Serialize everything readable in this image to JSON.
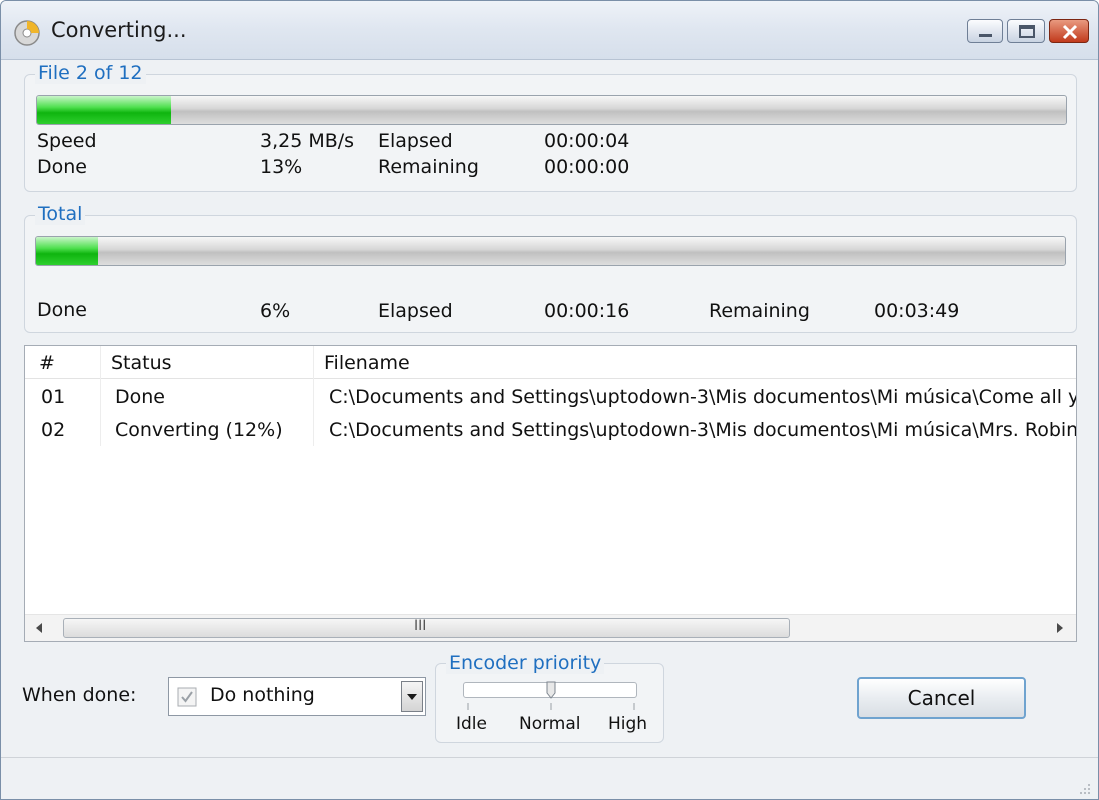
{
  "window": {
    "title": "Converting...",
    "icon": "disc-icon",
    "controls": [
      "minimize-icon",
      "maximize-icon",
      "close-icon"
    ]
  },
  "file_group": {
    "legend": "File 2 of 12",
    "progress_percent": 13,
    "speed_label": "Speed",
    "speed_value": "3,25 MB/s",
    "elapsed_label": "Elapsed",
    "elapsed_value": "00:00:04",
    "done_label": "Done",
    "done_value": "13%",
    "remaining_label": "Remaining",
    "remaining_value": "00:00:00"
  },
  "total_group": {
    "legend": "Total",
    "progress_percent": 6,
    "done_label": "Done",
    "done_value": "6%",
    "elapsed_label": "Elapsed",
    "elapsed_value": "00:00:16",
    "remaining_label": "Remaining",
    "remaining_value": "00:03:49"
  },
  "file_list": {
    "columns": [
      "#",
      "Status",
      "Filename"
    ],
    "rows": [
      {
        "num": "01",
        "status": "Done",
        "filename": "C:\\Documents and Settings\\uptodown-3\\Mis documentos\\Mi música\\Come all yet Fai"
      },
      {
        "num": "02",
        "status": "Converting (12%)",
        "filename": "C:\\Documents and Settings\\uptodown-3\\Mis documentos\\Mi música\\Mrs. Robinson.r"
      }
    ],
    "scrollbar_grip": "III"
  },
  "bottom": {
    "when_done_label": "When done:",
    "when_done_value": "Do nothing",
    "encoder_priority_legend": "Encoder priority",
    "priority_labels": [
      "Idle",
      "Normal",
      "High"
    ],
    "priority_level": "Normal",
    "cancel_label": "Cancel"
  },
  "colors": {
    "progress_green": "#1ec41e",
    "legend_blue": "#1f6fc0"
  }
}
